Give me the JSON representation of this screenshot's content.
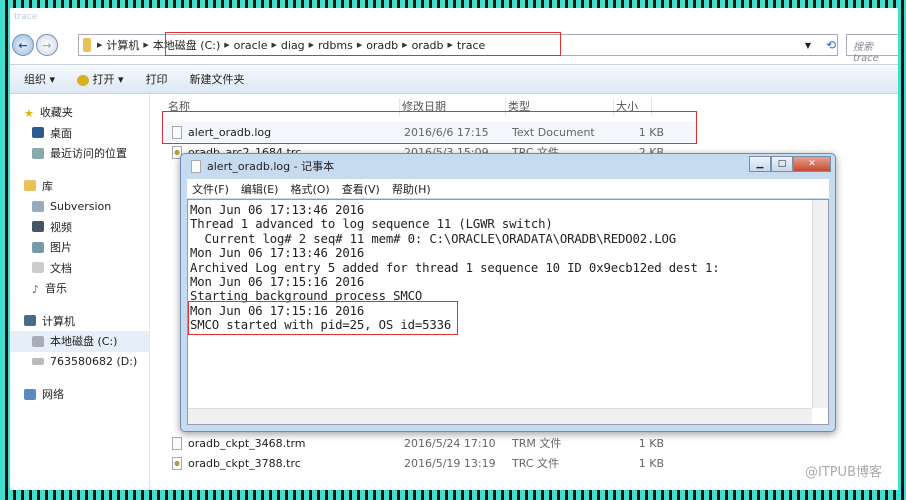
{
  "explorer": {
    "title": "trace",
    "breadcrumb": [
      "计算机",
      "本地磁盘 (C:)",
      "oracle",
      "diag",
      "rdbms",
      "oradb",
      "oradb",
      "trace"
    ],
    "search_placeholder": "搜索 trace",
    "toolbar": {
      "organize": "组织 ▾",
      "open": "打开 ▾",
      "print": "打印",
      "new_folder": "新建文件夹"
    },
    "sidebar": {
      "favorites": "收藏夹",
      "desktop": "桌面",
      "recent": "最近访问的位置",
      "libraries": "库",
      "subversion": "Subversion",
      "videos": "视频",
      "pictures": "图片",
      "documents": "文档",
      "music": "音乐",
      "computer": "计算机",
      "local_disk": "本地磁盘 (C:)",
      "drive_d": "763580682 (D:)",
      "network": "网络"
    },
    "columns": {
      "name": "名称",
      "date": "修改日期",
      "type": "类型",
      "size": "大小"
    },
    "files": [
      {
        "name": "alert_oradb.log",
        "date": "2016/6/6 17:15",
        "type": "Text Document",
        "size": "1 KB",
        "icon": "text-file"
      },
      {
        "name": "oradb_arc2_1684.trc",
        "date": "2016/5/3 15:09",
        "type": "TRC 文件",
        "size": "2 KB",
        "icon": "trc-file"
      },
      {
        "name": "oradb_ckpt_3468.trm",
        "date": "2016/5/24 17:10",
        "type": "TRM 文件",
        "size": "1 KB",
        "icon": "file"
      },
      {
        "name": "oradb_ckpt_3788.trc",
        "date": "2016/5/19 13:19",
        "type": "TRC 文件",
        "size": "1 KB",
        "icon": "trc-file"
      }
    ]
  },
  "notepad": {
    "title": "alert_oradb.log - 记事本",
    "menu": [
      "文件(F)",
      "编辑(E)",
      "格式(O)",
      "查看(V)",
      "帮助(H)"
    ],
    "lines": [
      "Mon Jun 06 17:13:46 2016",
      "Thread 1 advanced to log sequence 11 (LGWR switch)",
      "  Current log# 2 seq# 11 mem# 0: C:\\ORACLE\\ORADATA\\ORADB\\REDO02.LOG",
      "Mon Jun 06 17:13:46 2016",
      "Archived Log entry 5 added for thread 1 sequence 10 ID 0x9ecb12ed dest 1:",
      "Mon Jun 06 17:15:16 2016",
      "Starting background process SMCO",
      "Mon Jun 06 17:15:16 2016",
      "SMCO started with pid=25, OS id=5336"
    ]
  },
  "watermark": "@ITPUB博客",
  "colors": {
    "highlight": "#dd3333",
    "border_accent": "#3fe0d0"
  }
}
